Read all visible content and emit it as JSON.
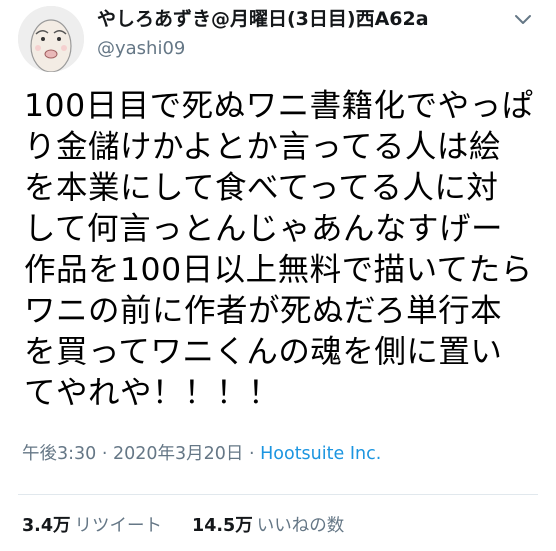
{
  "tweet": {
    "author": {
      "display_name": "やしろあずき@月曜日(3日目)西A62a",
      "handle": "@yashi09",
      "avatar_icon": "cartoon-face-avatar"
    },
    "text": "100日目で死ぬワニ書籍化でやっぱ\nり金儲けかよとか言ってる人は絵\nを本業にして食べてってる人に対\nして何言っとんじゃあんなすげー\n作品を100日以上無料で描いてたら\nワニの前に作者が死ぬだろ単行本\nを買ってワニくんの魂を側に置い\nてやれや！！！！",
    "timestamp": "午後3:30 · 2020年3月20日 · ",
    "source": "Hootsuite Inc.",
    "stats": {
      "retweets_count": "3.4万",
      "retweets_label": "リツイート",
      "likes_count": "14.5万",
      "likes_label": "いいねの数"
    }
  },
  "colors": {
    "primary_text": "#14171a",
    "secondary_text": "#657786",
    "link": "#1b95e0",
    "divider": "#e1e8ed"
  }
}
